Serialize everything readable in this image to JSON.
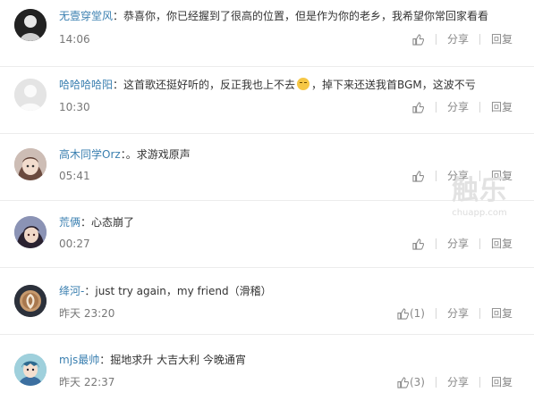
{
  "comments": [
    {
      "user": "无壹穿堂风",
      "sep": "：",
      "text": "恭喜你，你已经握到了很高的位置，但是作为你的老乡，我希望你常回家看看",
      "time": "14:06",
      "like_count": "",
      "share_label": "分享",
      "reply_label": "回复",
      "avatar_icon": "dark-portrait-avatar"
    },
    {
      "user": "哈哈哈哈阳",
      "sep": "：",
      "text": "这首歌还挺好听的，反正我也上不去",
      "emoji_icon": "smug-face-emoji",
      "text2": "，掉下来还送我首BGM，这波不亏",
      "time": "10:30",
      "like_count": "",
      "share_label": "分享",
      "reply_label": "回复",
      "avatar_icon": "default-user-avatar"
    },
    {
      "user": "高木同学Orz",
      "sep": "：",
      "text": "。求游戏原声",
      "time": "05:41",
      "like_count": "",
      "share_label": "分享",
      "reply_label": "回复",
      "avatar_icon": "anime-girl-avatar"
    },
    {
      "user": "荒俩",
      "sep": "：",
      "text": "心态崩了",
      "time": "00:27",
      "like_count": "",
      "share_label": "分享",
      "reply_label": "回复",
      "avatar_icon": "anime-dark-hair-avatar"
    },
    {
      "user": "绛河-",
      "sep": "：",
      "text": "just try again，my friend（滑稽）",
      "time": "昨天 23:20",
      "like_count": "(1)",
      "share_label": "分享",
      "reply_label": "回复",
      "avatar_icon": "latte-art-avatar"
    },
    {
      "user": "mjs最帅",
      "sep": "：",
      "text": "掘地求升 大吉大利 今晚通宵",
      "time": "昨天 22:37",
      "like_count": "(3)",
      "share_label": "分享",
      "reply_label": "回复",
      "avatar_icon": "anime-boy-avatar"
    }
  ],
  "watermark": {
    "logo": "触乐",
    "url": "chuapp.com"
  },
  "colors": {
    "username": "#3a7fb0",
    "meta": "#888888",
    "divider": "#ececec"
  }
}
